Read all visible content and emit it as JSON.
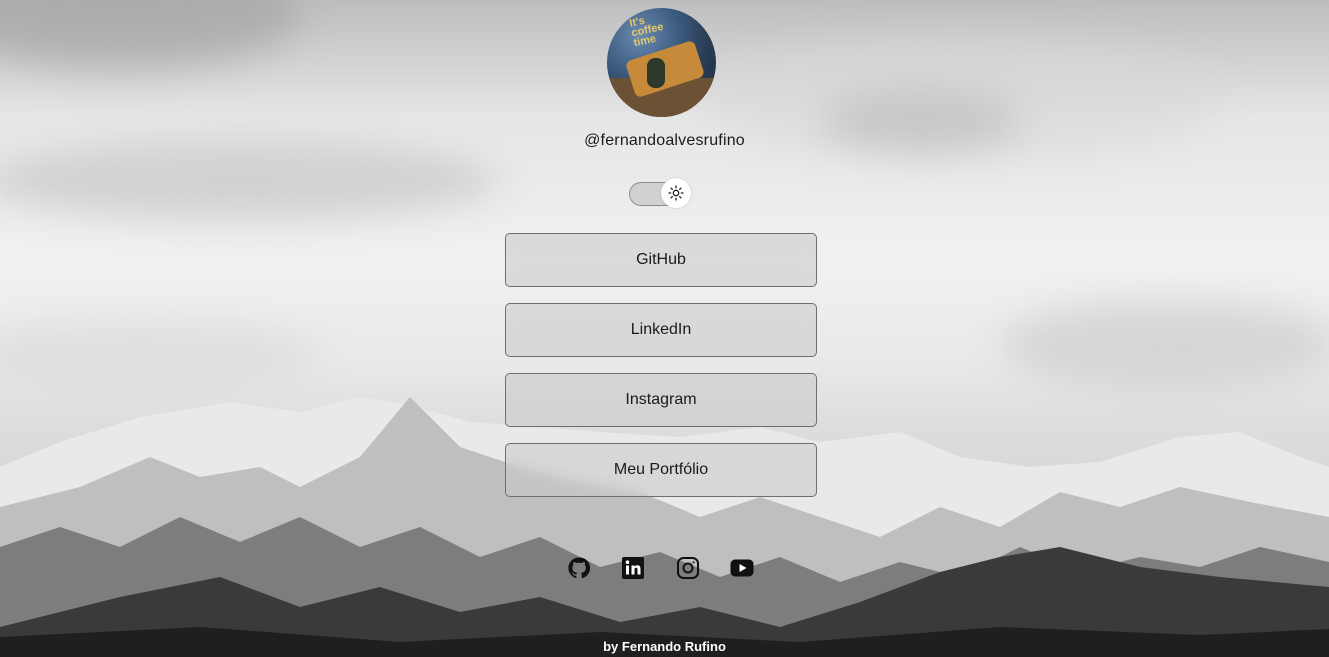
{
  "profile": {
    "username": "@fernandoalvesrufino",
    "avatar_alt": "profile photo"
  },
  "theme_toggle": {
    "icon": "sun-icon",
    "state": "light"
  },
  "links": [
    {
      "label": "GitHub"
    },
    {
      "label": "LinkedIn"
    },
    {
      "label": "Instagram"
    },
    {
      "label": "Meu Portfólio"
    }
  ],
  "social_icons": [
    "github-icon",
    "linkedin-icon",
    "instagram-icon",
    "youtube-icon"
  ],
  "footer": {
    "text": "by Fernando Rufino"
  }
}
